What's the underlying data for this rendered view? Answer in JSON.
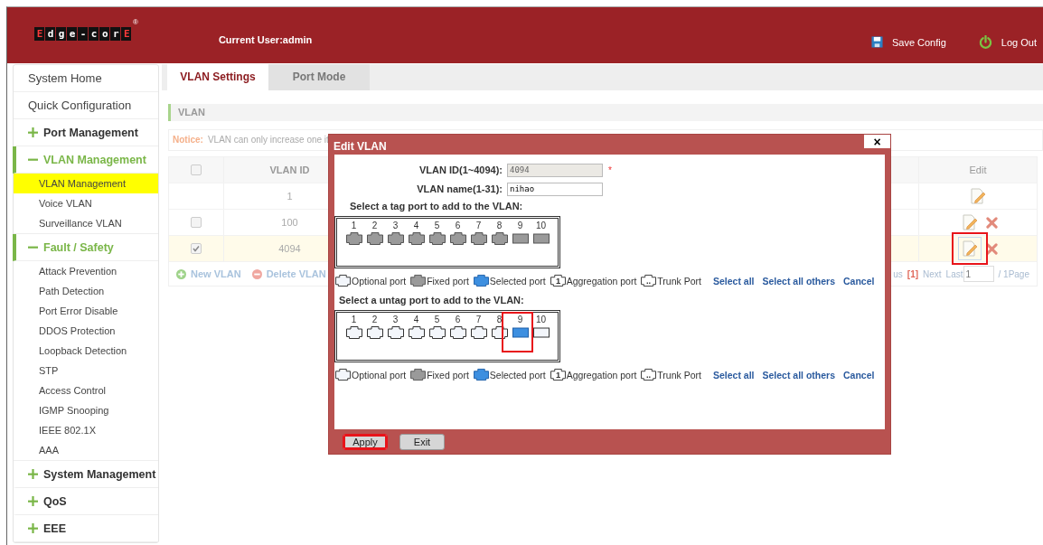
{
  "header": {
    "logo": "Edge-corE",
    "logo_mark": "®",
    "current_user": "Current User:admin",
    "actions": [
      {
        "kind": "save",
        "label": "Save Config"
      },
      {
        "kind": "logout",
        "label": "Log Out"
      }
    ]
  },
  "sidebar": {
    "items": [
      {
        "kind": "link",
        "label": "System Home"
      },
      {
        "kind": "link",
        "label": "Quick Configuration"
      },
      {
        "kind": "group",
        "label": "Port Management",
        "expanded": false
      },
      {
        "kind": "group",
        "label": "VLAN Management",
        "expanded": true,
        "children": [
          {
            "label": "VLAN Management",
            "selected": true
          },
          {
            "label": "Voice VLAN",
            "selected": false
          },
          {
            "label": "Surveillance VLAN",
            "selected": false
          }
        ]
      },
      {
        "kind": "group",
        "label": "Fault / Safety",
        "expanded": true,
        "children": [
          {
            "label": "Attack Prevention",
            "selected": false
          },
          {
            "label": "Path Detection",
            "selected": false
          },
          {
            "label": "Port Error Disable",
            "selected": false
          },
          {
            "label": "DDOS Protection",
            "selected": false
          },
          {
            "label": "Loopback Detection",
            "selected": false
          },
          {
            "label": "STP",
            "selected": false
          },
          {
            "label": "Access Control",
            "selected": false
          },
          {
            "label": "IGMP Snooping",
            "selected": false
          },
          {
            "label": "IEEE 802.1X",
            "selected": false
          },
          {
            "label": "AAA",
            "selected": false
          }
        ]
      },
      {
        "kind": "group",
        "label": "System Management",
        "expanded": false
      },
      {
        "kind": "group",
        "label": "QoS",
        "expanded": false
      },
      {
        "kind": "group",
        "label": "EEE",
        "expanded": false
      }
    ]
  },
  "tabs": [
    {
      "label": "VLAN Settings",
      "selected": true
    },
    {
      "label": "Port Mode",
      "selected": false
    }
  ],
  "section_title": "VLAN",
  "notice": {
    "label": "Notice:",
    "text": "VLAN can only increase one it"
  },
  "table": {
    "select_all_checked": false,
    "columns": [
      "VLAN ID",
      "Edit"
    ],
    "rows": [
      {
        "kind": "default",
        "vlan_id": "1",
        "selected": false,
        "edit_highlighted": false
      },
      {
        "kind": "custom",
        "vlan_id": "100",
        "selected": false,
        "edit_highlighted": false
      },
      {
        "kind": "custom",
        "vlan_id": "4094",
        "selected": true,
        "edit_highlighted": true
      }
    ]
  },
  "table_actions": [
    {
      "kind": "add",
      "label": "New VLAN"
    },
    {
      "kind": "delete",
      "label": "Delete VLAN"
    }
  ],
  "pagination": {
    "previous": "us",
    "current": "[1]",
    "next": "Next",
    "last": "Last",
    "page_value": "1",
    "total": "/ 1Page"
  },
  "dialog": {
    "title": "Edit VLAN",
    "close": "×",
    "fields": [
      {
        "label": "VLAN ID(1~4094):",
        "value": "4094",
        "disabled": true,
        "required_mark": "*"
      },
      {
        "label": "VLAN name(1-31):",
        "value": "nihao",
        "disabled": false
      }
    ],
    "port_groups": [
      {
        "title": "Select a tag port to add to the VLAN:",
        "ports": [
          {
            "number": "1",
            "kind": "rj45",
            "fixed": true,
            "selected": false,
            "highlighted": false
          },
          {
            "number": "2",
            "kind": "rj45",
            "fixed": true,
            "selected": false,
            "highlighted": false
          },
          {
            "number": "3",
            "kind": "rj45",
            "fixed": true,
            "selected": false,
            "highlighted": false
          },
          {
            "number": "4",
            "kind": "rj45",
            "fixed": true,
            "selected": false,
            "highlighted": false
          },
          {
            "number": "5",
            "kind": "rj45",
            "fixed": true,
            "selected": false,
            "highlighted": false
          },
          {
            "number": "6",
            "kind": "rj45",
            "fixed": true,
            "selected": false,
            "highlighted": false
          },
          {
            "number": "7",
            "kind": "rj45",
            "fixed": true,
            "selected": false,
            "highlighted": false
          },
          {
            "number": "8",
            "kind": "rj45",
            "fixed": true,
            "selected": false,
            "highlighted": false
          },
          {
            "number": "9",
            "kind": "sfp",
            "fixed": true,
            "selected": false,
            "highlighted": false
          },
          {
            "number": "10",
            "kind": "sfp",
            "fixed": true,
            "selected": false,
            "highlighted": false
          }
        ],
        "legend": [
          {
            "kind": "optional",
            "label": "Optional port"
          },
          {
            "kind": "fixed",
            "label": "Fixed port"
          },
          {
            "kind": "selected",
            "label": "Selected port"
          },
          {
            "kind": "aggregation",
            "label": "Aggregation port",
            "icon_text": "1"
          },
          {
            "kind": "trunk",
            "label": "Trunk Port",
            "icon_text": ".."
          }
        ],
        "links": [
          "Select all",
          "Select all others",
          "Cancel"
        ]
      },
      {
        "title": "Select a untag port to add to the VLAN:",
        "ports": [
          {
            "number": "1",
            "kind": "rj45",
            "fixed": false,
            "selected": false,
            "highlighted": false
          },
          {
            "number": "2",
            "kind": "rj45",
            "fixed": false,
            "selected": false,
            "highlighted": false
          },
          {
            "number": "3",
            "kind": "rj45",
            "fixed": false,
            "selected": false,
            "highlighted": false
          },
          {
            "number": "4",
            "kind": "rj45",
            "fixed": false,
            "selected": false,
            "highlighted": false
          },
          {
            "number": "5",
            "kind": "rj45",
            "fixed": false,
            "selected": false,
            "highlighted": false
          },
          {
            "number": "6",
            "kind": "rj45",
            "fixed": false,
            "selected": false,
            "highlighted": false
          },
          {
            "number": "7",
            "kind": "rj45",
            "fixed": false,
            "selected": false,
            "highlighted": false
          },
          {
            "number": "8",
            "kind": "rj45",
            "fixed": false,
            "selected": false,
            "highlighted": false
          },
          {
            "number": "9",
            "kind": "sfp",
            "fixed": false,
            "selected": true,
            "highlighted": true
          },
          {
            "number": "10",
            "kind": "sfp",
            "fixed": false,
            "selected": false,
            "highlighted": false
          }
        ],
        "legend": [
          {
            "kind": "optional",
            "label": "Optional port"
          },
          {
            "kind": "fixed",
            "label": "Fixed port"
          },
          {
            "kind": "selected",
            "label": "Selected port"
          },
          {
            "kind": "aggregation",
            "label": "Aggregation port",
            "icon_text": "1"
          },
          {
            "kind": "trunk",
            "label": "Trunk Port",
            "icon_text": ".."
          }
        ],
        "links": [
          "Select all",
          "Select all others",
          "Cancel"
        ]
      }
    ],
    "buttons": [
      {
        "label": "Apply",
        "highlighted": true
      },
      {
        "label": "Exit",
        "highlighted": false
      }
    ]
  }
}
